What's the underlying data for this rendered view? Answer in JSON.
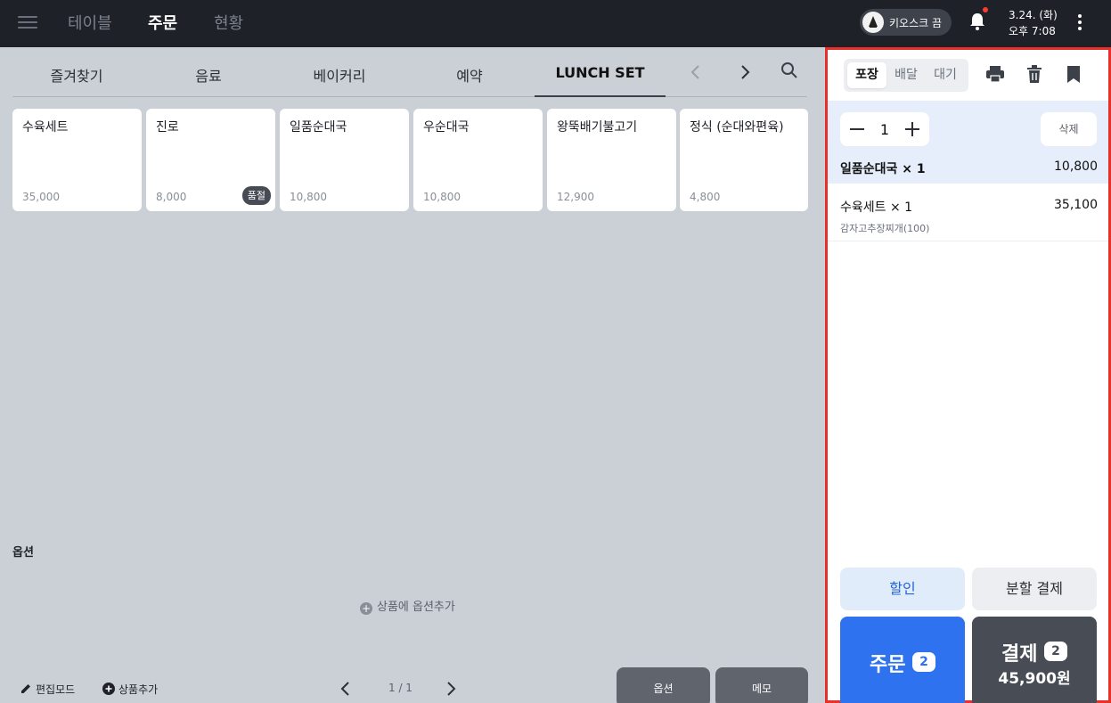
{
  "topbar": {
    "nav": [
      {
        "label": "테이블",
        "active": false
      },
      {
        "label": "주문",
        "active": true
      },
      {
        "label": "현황",
        "active": false
      }
    ],
    "kiosk_label": "키오스크 끔",
    "date": "3.24. (화)",
    "time": "오후 7:08",
    "notification_dot_color": "#ff3b30"
  },
  "categories": [
    {
      "label": "즐겨찾기"
    },
    {
      "label": "음료"
    },
    {
      "label": "베이커리"
    },
    {
      "label": "예약"
    },
    {
      "label": "LUNCH SET",
      "active": true
    }
  ],
  "products": [
    {
      "name": "수육세트",
      "price": "35,000"
    },
    {
      "name": "진로",
      "price": "8,000",
      "badge": "품절"
    },
    {
      "name": "일품순대국",
      "price": "10,800"
    },
    {
      "name": "우순대국",
      "price": "10,800"
    },
    {
      "name": "왕뚝배기불고기",
      "price": "12,900"
    },
    {
      "name": "정식 (순대와편육)",
      "price": "4,800"
    }
  ],
  "options": {
    "title": "옵션",
    "add_label": "상품에 옵션추가"
  },
  "bottom_bar": {
    "edit_mode": "편집모드",
    "add_product": "상품추가",
    "page": "1 / 1",
    "option_btn": "옵션",
    "memo_btn": "메모"
  },
  "order_panel": {
    "types": [
      {
        "label": "포장",
        "active": true
      },
      {
        "label": "배달",
        "active": false
      },
      {
        "label": "대기",
        "active": false
      }
    ],
    "quantity": "1",
    "delete_label": "삭제",
    "items": [
      {
        "name": "일품순대국 × 1",
        "price": "10,800",
        "selected": true
      },
      {
        "name": "수육세트 × 1",
        "price": "35,100",
        "sub": "감자고추장찌개(100)"
      }
    ],
    "discount_label": "할인",
    "split_label": "분할 결제",
    "order_label": "주문",
    "order_count": "2",
    "pay_label": "결제",
    "pay_count": "2",
    "pay_amount": "45,900원"
  },
  "colors": {
    "accent_blue": "#2f72f0",
    "highlight_border": "#e8302a",
    "topbar_bg": "#1e2128"
  }
}
